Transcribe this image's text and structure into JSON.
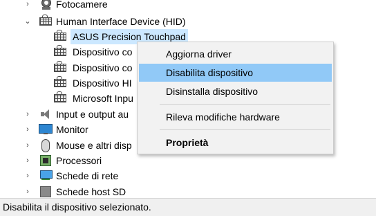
{
  "tree": {
    "fotocamere": "Fotocamere",
    "hid": "Human Interface Device (HID)",
    "hid_children": [
      "ASUS Precision Touchpad",
      "Dispositivo co",
      "Dispositivo co",
      "Dispositivo HI",
      "Microsoft Inpu"
    ],
    "input_output": "Input e output au",
    "monitor": "Monitor",
    "mouse": "Mouse e altri disp",
    "processori": "Processori",
    "schede_rete": "Schede di rete",
    "schede_sd": "Schede host SD",
    "collapsed_glyph": "›",
    "expanded_glyph": "⌄"
  },
  "context_menu": {
    "items": [
      {
        "label": "Aggiorna driver"
      },
      {
        "label": "Disabilita dispositivo"
      },
      {
        "label": "Disinstalla dispositivo"
      },
      {
        "label": "Rileva modifiche hardware"
      },
      {
        "label": "Proprietà"
      }
    ],
    "highlight_color": "#91c9f7"
  },
  "status_bar": {
    "text": "Disabilita il dispositivo selezionato."
  },
  "colors": {
    "selection": "#cce8ff"
  }
}
